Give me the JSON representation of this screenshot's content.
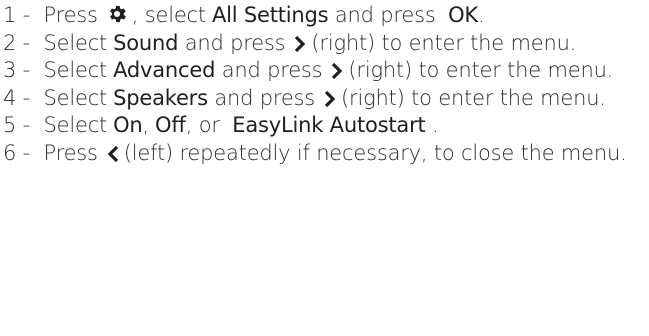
{
  "steps": [
    {
      "num": "1 -",
      "verb": "Press",
      "icon": "gear-icon",
      "text_after_icon": ", select",
      "bold1": "All Settings",
      "text_mid": "and press",
      "bold2": "OK",
      "text_end": "."
    },
    {
      "num": "2 -",
      "verb": "Select",
      "bold1": "Sound",
      "text_mid": "and press",
      "icon": "chevron-right-icon",
      "text_end": "(right) to enter the menu."
    },
    {
      "num": "3 -",
      "verb": "Select",
      "bold1": "Advanced",
      "text_mid": "and press",
      "icon": "chevron-right-icon",
      "text_end": "(right) to enter the menu."
    },
    {
      "num": "4 -",
      "verb": "Select",
      "bold1": "Speakers",
      "text_mid": "and press",
      "icon": "chevron-right-icon",
      "text_end": "(right) to enter the menu."
    },
    {
      "num": "5 -",
      "verb": "Select",
      "bold1": "On",
      "sep1": ",",
      "bold2": "Off",
      "text_mid": ", or",
      "bold3": "EasyLink Autostart",
      "text_end": "."
    },
    {
      "num": "6 -",
      "verb": "Press",
      "icon": "chevron-left-icon",
      "text_end": "(left) repeatedly if necessary, to close the menu."
    }
  ]
}
